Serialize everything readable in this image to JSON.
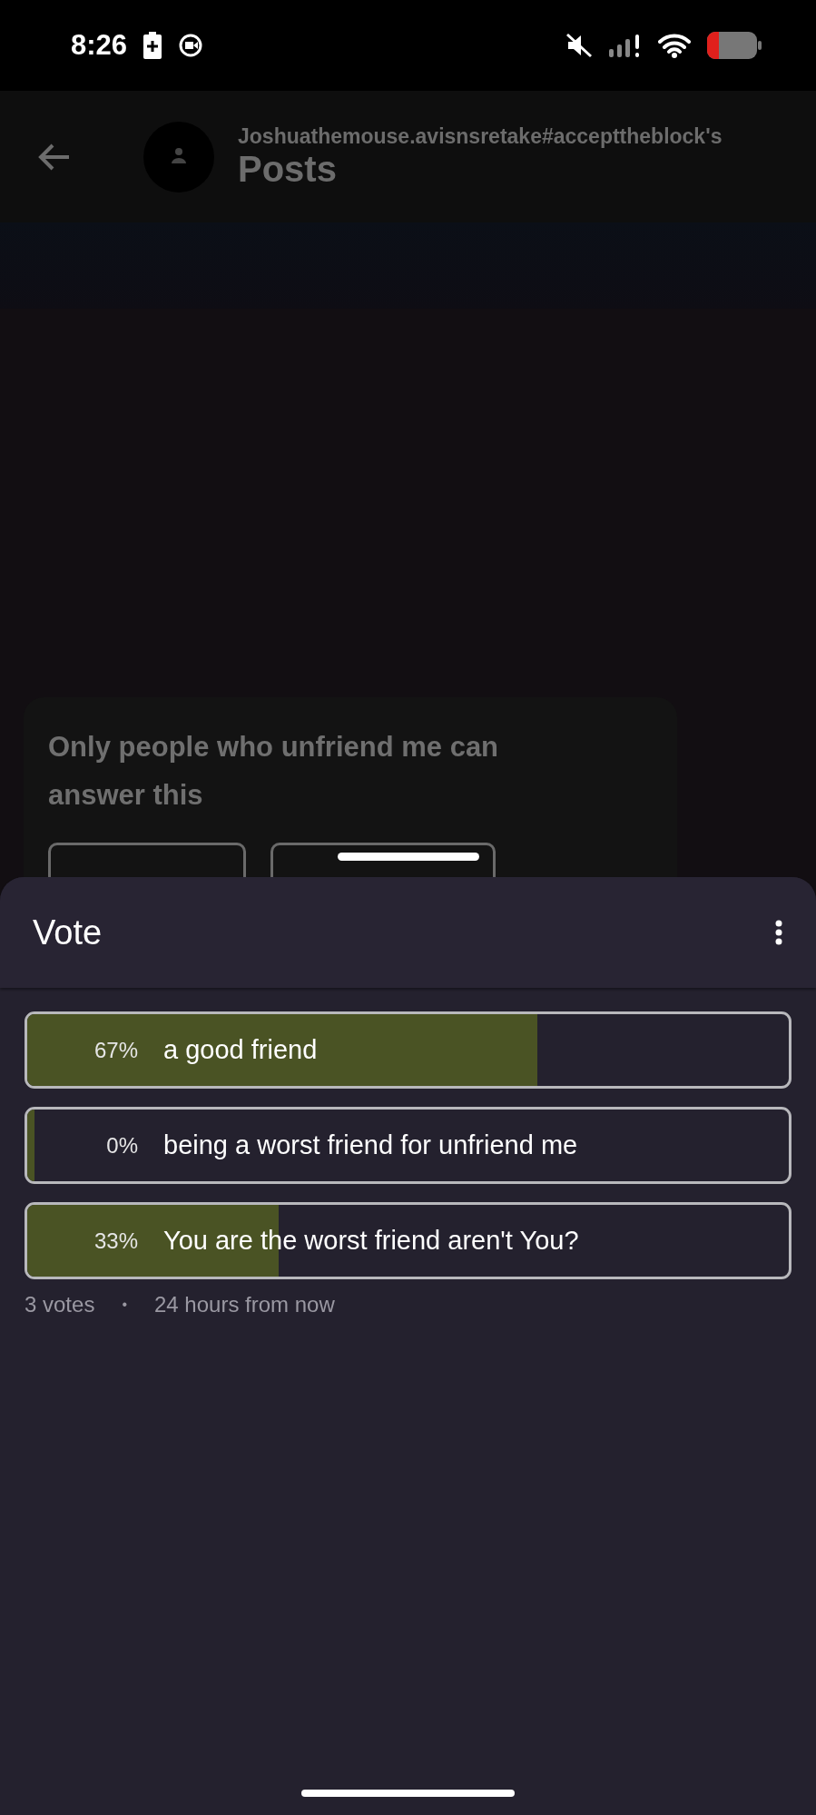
{
  "status_bar": {
    "time": "8:26"
  },
  "header": {
    "subtitle": "Joshuathemouse.avisnsretake#accepttheblock's",
    "title": "Posts"
  },
  "post": {
    "text": "Only people who unfriend me can answer this"
  },
  "sheet": {
    "title": "Vote",
    "options": [
      {
        "percent": "67%",
        "label": "a good friend",
        "level": 0.67
      },
      {
        "percent": "0%",
        "label": "being a worst friend for unfriend me",
        "level": 0.01
      },
      {
        "percent": "33%",
        "label": "You are the worst friend aren't You?",
        "level": 0.33
      }
    ],
    "votes": "3 votes",
    "separator": "•",
    "time_left": "24 hours from now"
  }
}
